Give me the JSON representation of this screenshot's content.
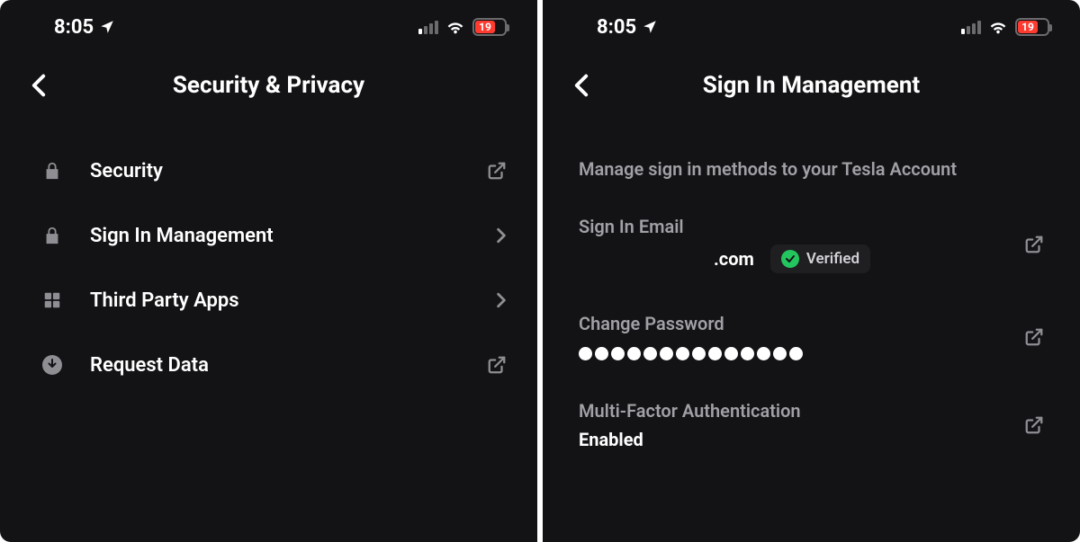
{
  "status": {
    "time": "8:05",
    "battery_pct": "19"
  },
  "left": {
    "title": "Security & Privacy",
    "items": [
      {
        "label": "Security"
      },
      {
        "label": "Sign In Management"
      },
      {
        "label": "Third Party Apps"
      },
      {
        "label": "Request Data"
      }
    ]
  },
  "right": {
    "title": "Sign In Management",
    "subtitle": "Manage sign in methods to your Tesla Account",
    "email": {
      "label": "Sign In Email",
      "domain": ".com",
      "verified_label": "Verified"
    },
    "password": {
      "label": "Change Password",
      "dot_count": 14
    },
    "mfa": {
      "label": "Multi-Factor Authentication",
      "status": "Enabled"
    }
  }
}
